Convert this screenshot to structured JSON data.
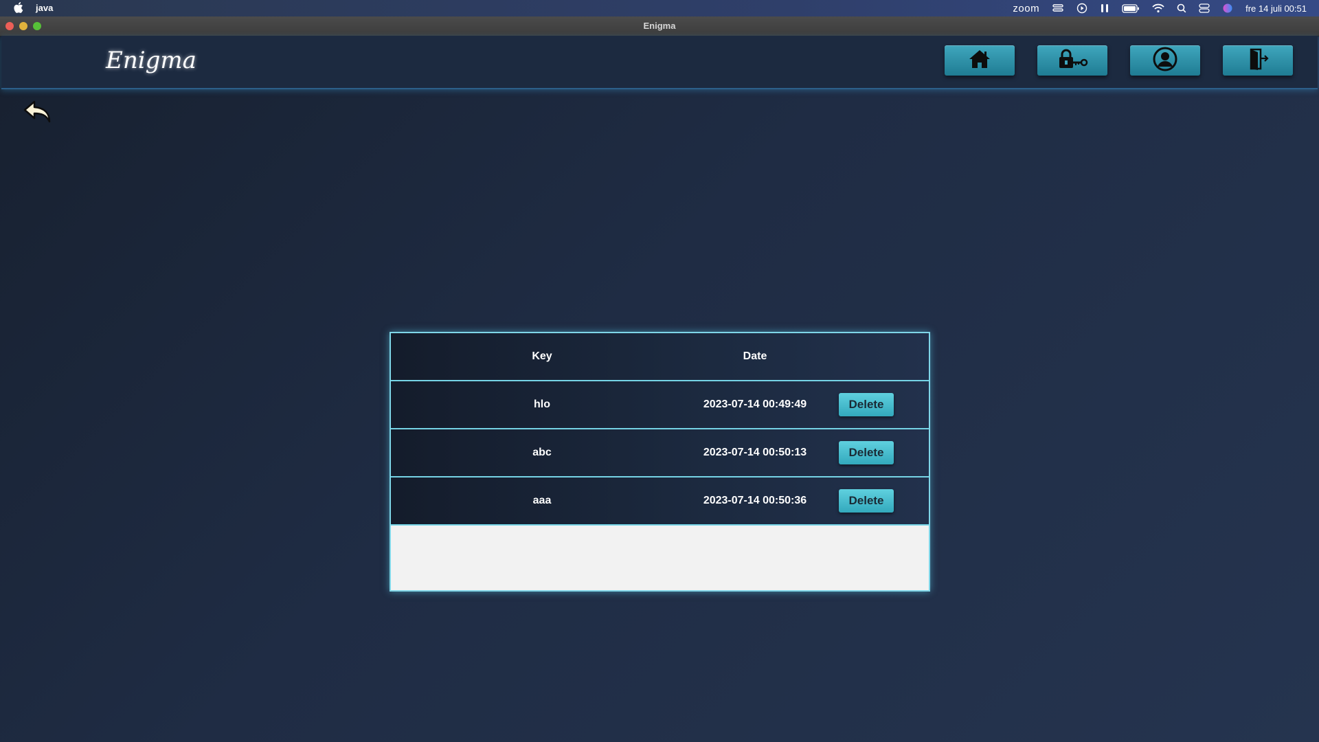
{
  "menubar": {
    "app_name": "java",
    "zoom_label": "zoom",
    "clock": "fre 14 juli 00:51"
  },
  "window": {
    "title": "Enigma"
  },
  "header": {
    "logo": "Enigma",
    "nav": [
      {
        "icon": "home-icon"
      },
      {
        "icon": "lock-key-icon"
      },
      {
        "icon": "user-icon"
      },
      {
        "icon": "logout-door-icon"
      }
    ]
  },
  "back": {
    "icon": "back-arrow-icon"
  },
  "table": {
    "headers": {
      "key": "Key",
      "date": "Date"
    },
    "rows": [
      {
        "key": "hlo",
        "date": "2023-07-14 00:49:49",
        "action": "Delete"
      },
      {
        "key": "abc",
        "date": "2023-07-14 00:50:13",
        "action": "Delete"
      },
      {
        "key": "aaa",
        "date": "2023-07-14 00:50:36",
        "action": "Delete"
      }
    ]
  },
  "colors": {
    "accent": "#3fa6bd",
    "border_glow": "#7fd6e8",
    "background": "#1c2a40"
  }
}
